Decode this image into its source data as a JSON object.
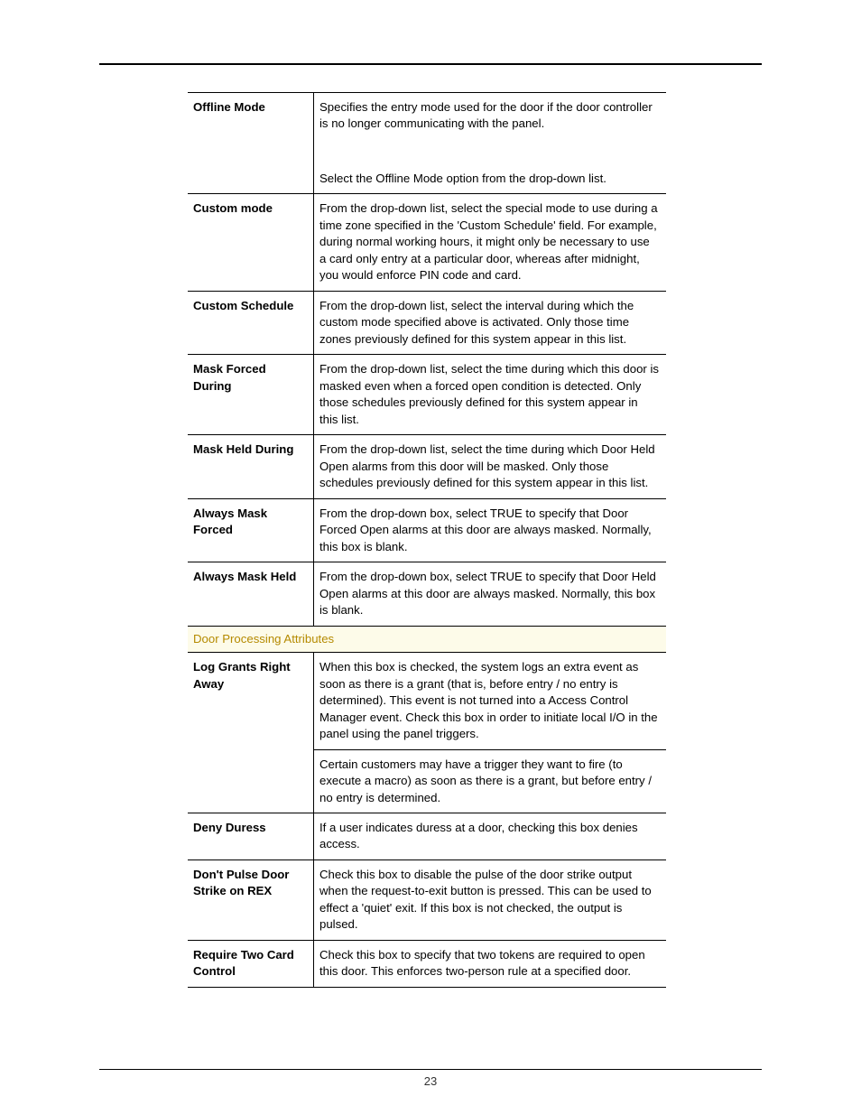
{
  "page_number": "23",
  "section_header": "Door Processing Attributes",
  "rows_a": [
    {
      "label": "Offline Mode",
      "paras": [
        "Specifies the entry mode used for the door if the door controller is no longer communicating with the panel.",
        "Select the Offline Mode option from the drop-down list."
      ]
    },
    {
      "label": "Custom mode",
      "paras": [
        "From the drop-down list, select the special mode to use during a time zone specified in the 'Custom Schedule' field. For example, during normal working hours, it might only be necessary to use a card only entry at a particular door, whereas after midnight, you would enforce PIN code and card."
      ]
    },
    {
      "label": "Custom Schedule",
      "paras": [
        "From the drop-down list, select the interval during which the custom mode specified above is activated. Only those time zones previously defined for this system appear in this list."
      ]
    },
    {
      "label": "Mask Forced During",
      "paras": [
        "From the drop-down list, select the time during which this door is masked even when a forced open condition is detected. Only those schedules previously defined for this system appear in this list."
      ]
    },
    {
      "label": "Mask Held During",
      "paras": [
        "From the drop-down list, select the time during which Door Held Open alarms from this door will be masked. Only those schedules previously defined for this system appear in this list."
      ]
    },
    {
      "label": "Always Mask Forced",
      "paras": [
        "From the drop-down box, select TRUE to specify that Door Forced Open alarms at this door are always masked. Normally, this box is blank."
      ]
    },
    {
      "label": "Always Mask Held",
      "paras": [
        "From the drop-down box, select TRUE to specify that Door Held Open alarms at this door are always masked. Normally, this box is blank."
      ]
    }
  ],
  "rows_b": [
    {
      "label": "Log Grants Right Away",
      "paras": [
        "When this box is checked, the system logs an extra event as soon as there is a grant (that is, before entry / no entry is determined). This event is not turned into a Access Control Manager event. Check this box in order to initiate local I/O in the panel using the panel triggers.",
        "Certain customers may have a trigger they want to fire (to execute a macro) as soon as there is a grant, but before  entry / no entry is determined."
      ],
      "split": true
    },
    {
      "label": "Deny Duress",
      "paras": [
        "If a user indicates duress at a door, checking this box denies access."
      ]
    },
    {
      "label": "Don't Pulse Door Strike on REX",
      "paras": [
        "Check this box to disable the pulse of the door strike output when the request-to-exit button is pressed. This can be used to effect a 'quiet' exit.  If this box is not checked, the output is pulsed."
      ]
    },
    {
      "label": "Require Two Card Control",
      "paras": [
        "Check this box to specify that two tokens are required to open this door. This enforces two-person rule at a specified door."
      ]
    }
  ]
}
